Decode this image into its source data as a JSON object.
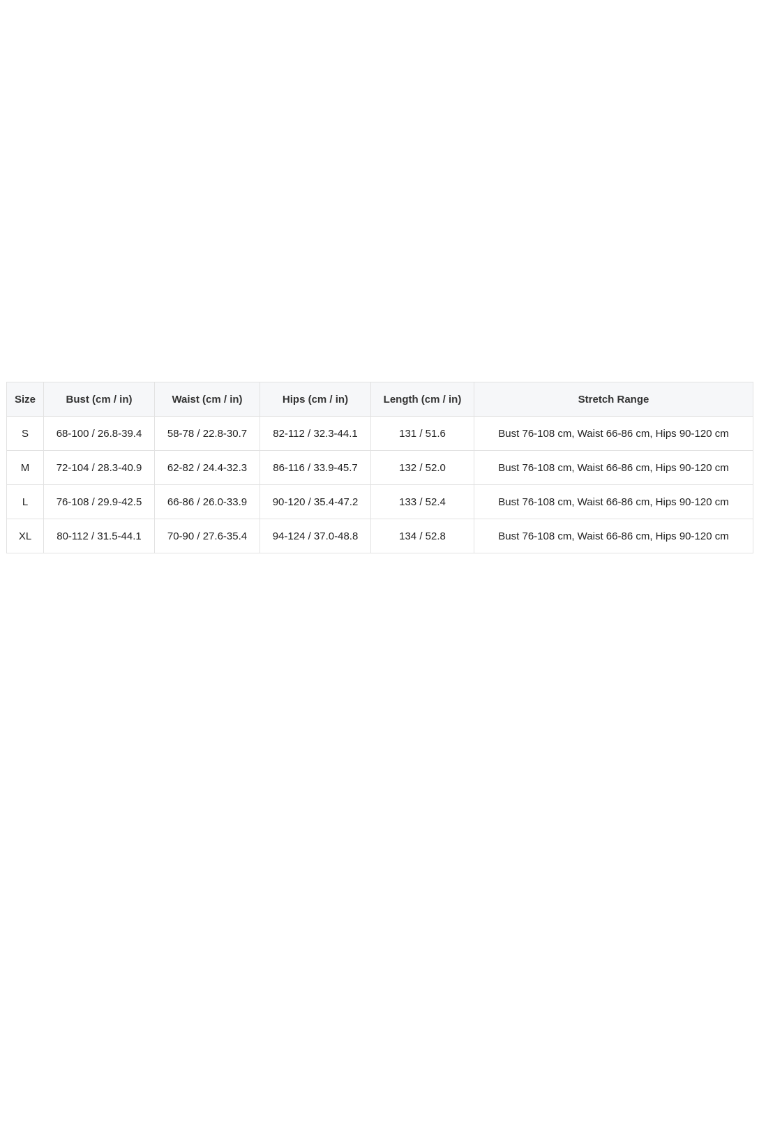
{
  "size_chart": {
    "headers": [
      "Size",
      "Bust (cm / in)",
      "Waist (cm / in)",
      "Hips (cm / in)",
      "Length (cm / in)",
      "Stretch Range"
    ],
    "rows": [
      [
        "S",
        "68-100 / 26.8-39.4",
        "58-78 / 22.8-30.7",
        "82-112 / 32.3-44.1",
        "131 / 51.6",
        "Bust 76-108 cm, Waist 66-86 cm, Hips 90-120 cm"
      ],
      [
        "M",
        "72-104 / 28.3-40.9",
        "62-82 / 24.4-32.3",
        "86-116 / 33.9-45.7",
        "132 / 52.0",
        "Bust 76-108 cm, Waist 66-86 cm, Hips 90-120 cm"
      ],
      [
        "L",
        "76-108 / 29.9-42.5",
        "66-86 / 26.0-33.9",
        "90-120 / 35.4-47.2",
        "133 / 52.4",
        "Bust 76-108 cm, Waist 66-86 cm, Hips 90-120 cm"
      ],
      [
        "XL",
        "80-112 / 31.5-44.1",
        "70-90 / 27.6-35.4",
        "94-124 / 37.0-48.8",
        "134 / 52.8",
        "Bust 76-108 cm, Waist 66-86 cm, Hips 90-120 cm"
      ]
    ]
  },
  "colors": {
    "header_background": "#f6f7f9",
    "border": "#e2e2e2",
    "text": "#222222"
  }
}
